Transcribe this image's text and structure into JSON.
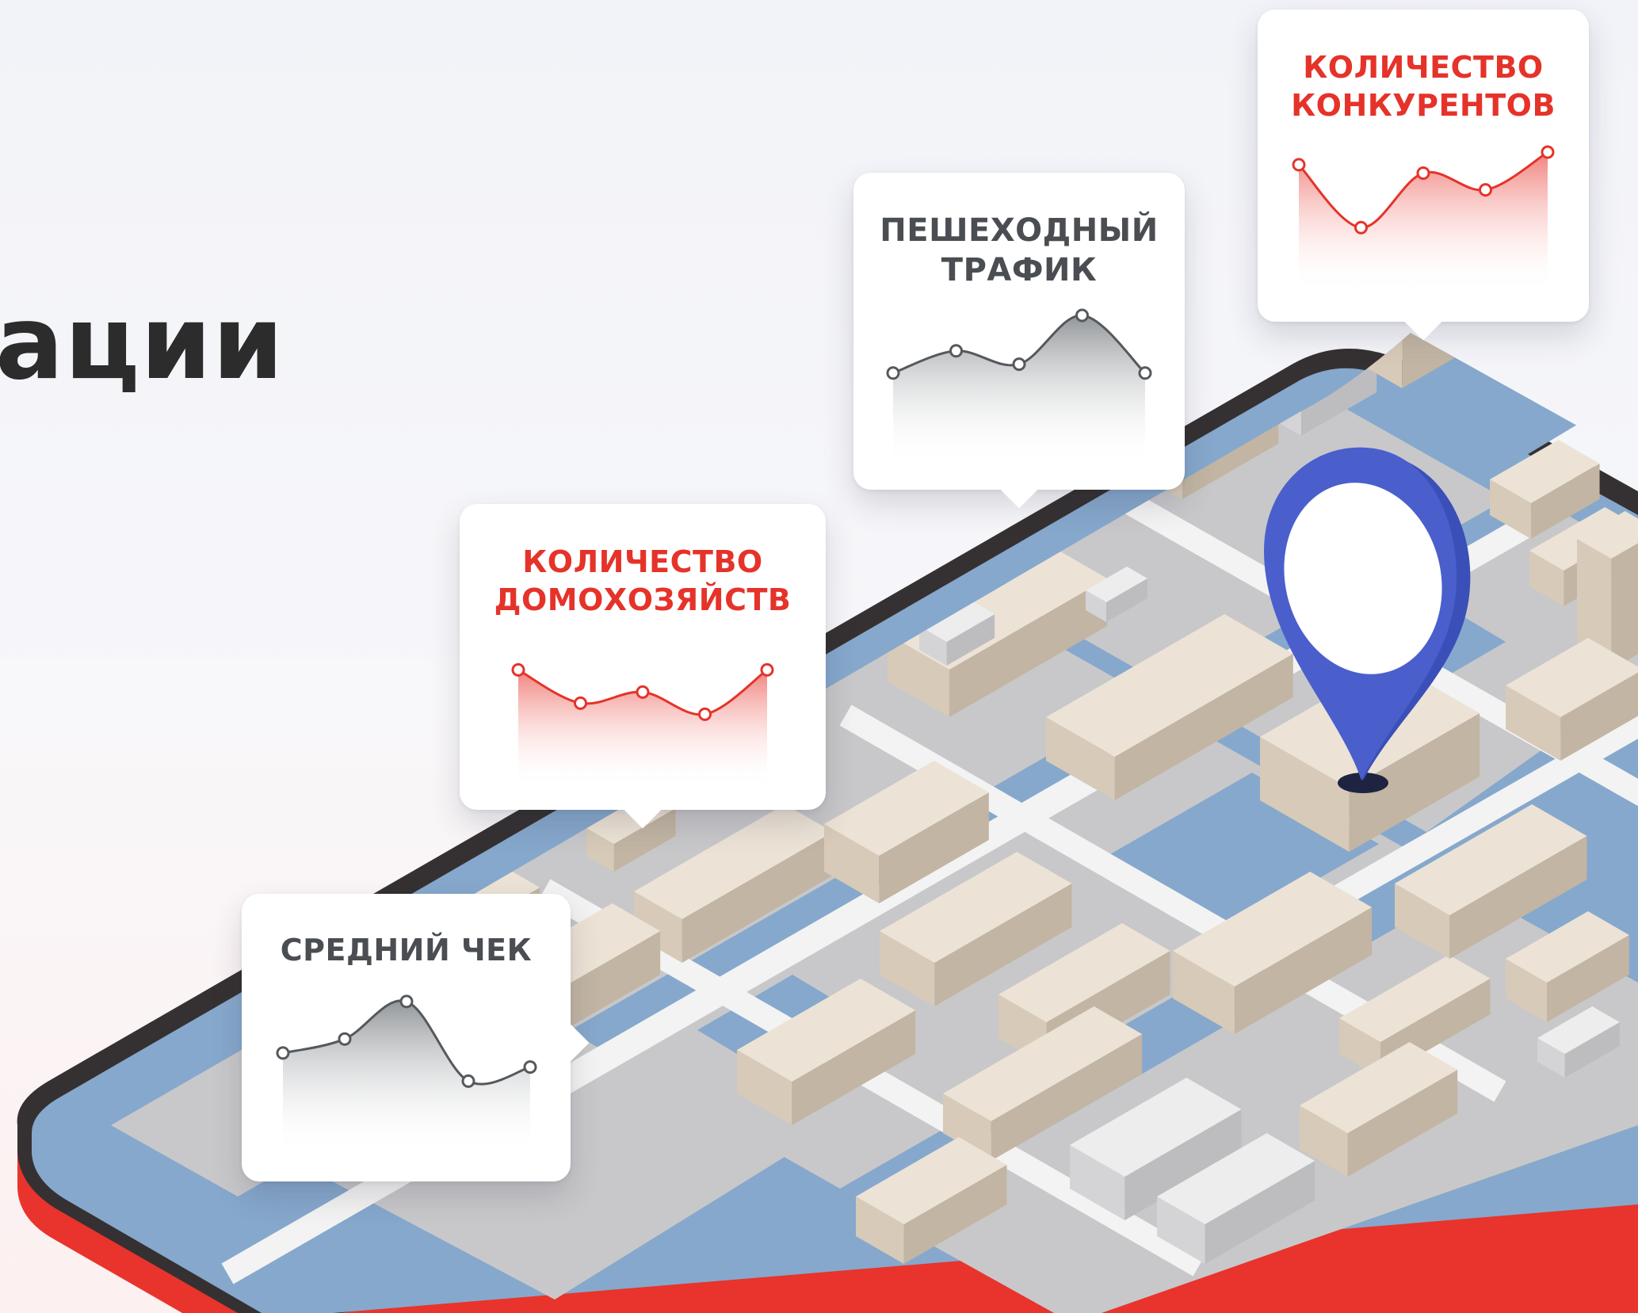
{
  "heading": "ации",
  "cards": {
    "avg_check": {
      "title": "СРЕДНИЙ ЧЕК",
      "tone": "gray",
      "trend": [
        0.4,
        0.55,
        0.95,
        0.1,
        0.25
      ]
    },
    "households": {
      "title": "КОЛИЧЕСТВО\nДОМОХОЗЯЙСТВ",
      "tone": "red",
      "trend": [
        0.9,
        0.45,
        0.6,
        0.3,
        0.9
      ]
    },
    "foot_traffic": {
      "title": "ПЕШЕХОДНЫЙ\nТРАФИК",
      "tone": "gray",
      "trend": [
        0.35,
        0.6,
        0.45,
        1.0,
        0.35
      ]
    },
    "competitors": {
      "title": "КОЛИЧЕСТВО\nКОНКУРЕНТОВ",
      "tone": "red",
      "trend": [
        0.85,
        0.1,
        0.75,
        0.55,
        1.0
      ]
    }
  },
  "colors": {
    "accent_red": "#e5332a",
    "title_gray": "#4a4d52",
    "water": "#86a8cc",
    "ground": "#c8c8ca",
    "road": "#f3f3f3",
    "building_top": "#ece3d6",
    "building_left": "#d7cab8",
    "building_right": "#c2b5a3",
    "phone_body": "#e8342c",
    "phone_frame": "#353132",
    "pin": "#4a5fcc"
  },
  "icons": {
    "location_pin": "map-pin-icon"
  }
}
